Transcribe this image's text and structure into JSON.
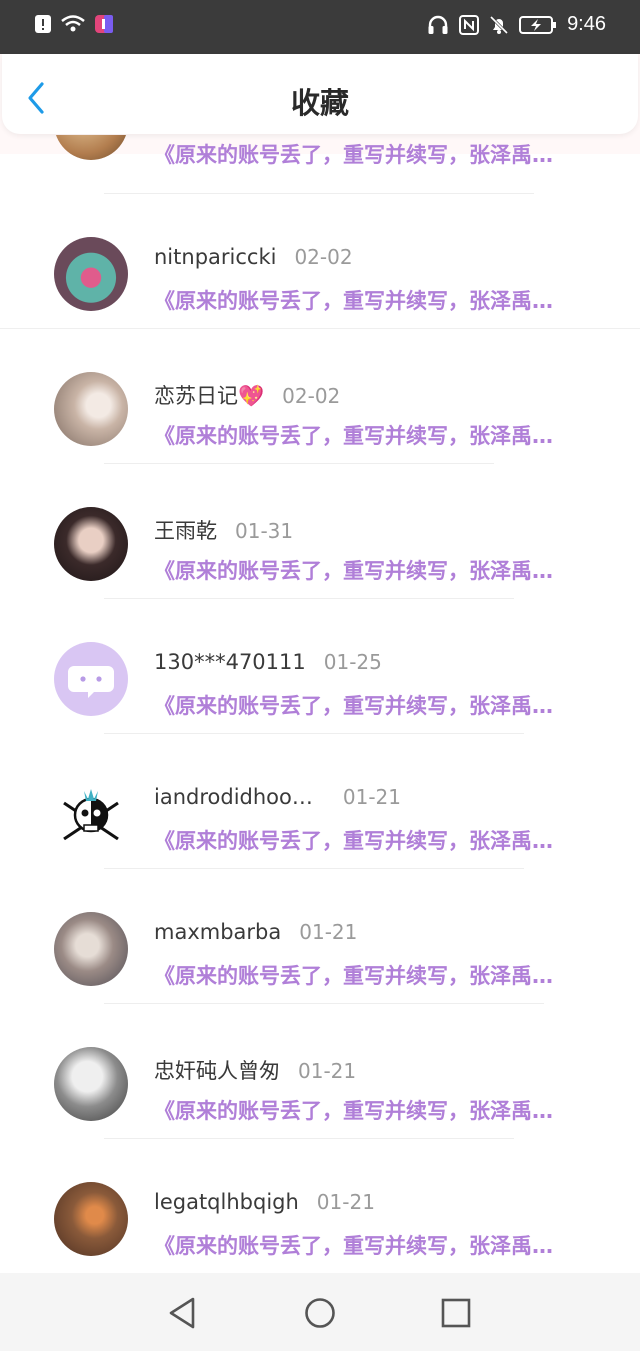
{
  "status_bar": {
    "time": "9:46",
    "icons_left": [
      "alert-icon",
      "wifi-icon",
      "app-notification-icon"
    ],
    "icons_right": [
      "headphones-icon",
      "nfc-icon",
      "mute-bell-icon",
      "battery-icon"
    ]
  },
  "header": {
    "title": "收藏",
    "back_icon": "chevron-left-icon"
  },
  "favorites": [
    {
      "name": "",
      "date": "",
      "excerpt": "《原来的账号丢了，重写并续写，张泽禹…",
      "avatar_color": "#c9a06b",
      "partial": true
    },
    {
      "name": "nitnpariccki",
      "date": "02-02",
      "excerpt": "《原来的账号丢了，重写并续写，张泽禹…",
      "avatar_color": "#7a6a88"
    },
    {
      "name": "恋苏日记💖",
      "date": "02-02",
      "excerpt": "《原来的账号丢了，重写并续写，张泽禹…",
      "avatar_color": "#d8c9c0"
    },
    {
      "name": "王雨乾",
      "date": "01-31",
      "excerpt": "《原来的账号丢了，重写并续写，张泽禹…",
      "avatar_color": "#3a2e34"
    },
    {
      "name": "130***470111",
      "date": "01-25",
      "excerpt": "《原来的账号丢了，重写并续写，张泽禹…",
      "avatar_color": "#d9c6f3"
    },
    {
      "name": "iandrodidhoo…",
      "date": "01-21",
      "excerpt": "《原来的账号丢了，重写并续写，张泽禹…",
      "avatar_color": "#ffffff"
    },
    {
      "name": "maxmbarba",
      "date": "01-21",
      "excerpt": "《原来的账号丢了，重写并续写，张泽禹…",
      "avatar_color": "#a89a9a"
    },
    {
      "name": "忠奸砘人曾匆",
      "date": "01-21",
      "excerpt": "《原来的账号丢了，重写并续写，张泽禹…",
      "avatar_color": "#8c8c8c"
    },
    {
      "name": "legatqlhbqigh",
      "date": "01-21",
      "excerpt": "《原来的账号丢了，重写并续写，张泽禹…",
      "avatar_color": "#8a5a3a"
    }
  ],
  "nav": {
    "back_icon": "triangle-back-icon",
    "home_icon": "circle-home-icon",
    "recents_icon": "square-recents-icon"
  }
}
